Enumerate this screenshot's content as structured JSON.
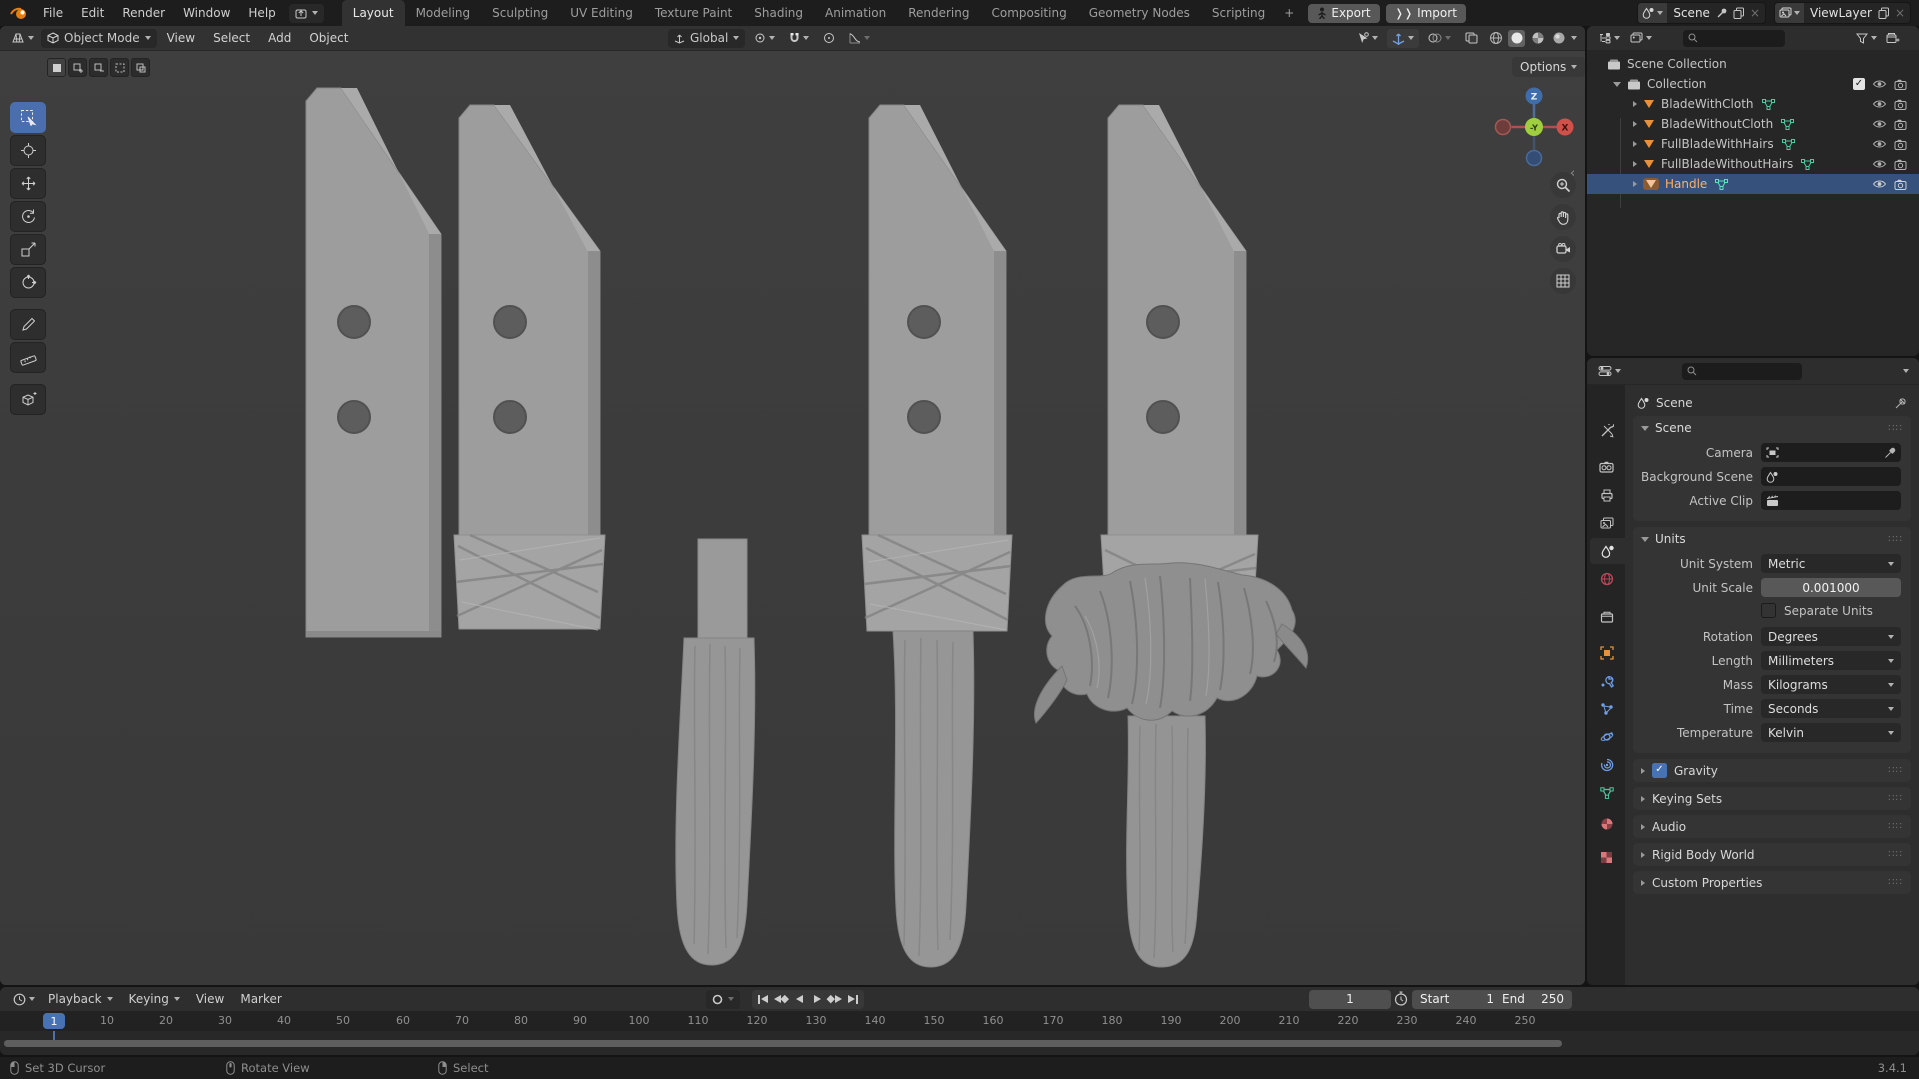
{
  "topbar": {
    "menus": [
      "File",
      "Edit",
      "Render",
      "Window",
      "Help"
    ],
    "workspaces": [
      "Layout",
      "Modeling",
      "Sculpting",
      "UV Editing",
      "Texture Paint",
      "Shading",
      "Animation",
      "Rendering",
      "Compositing",
      "Geometry Nodes",
      "Scripting"
    ],
    "active_workspace": "Layout",
    "add_tab": "+",
    "export_button": "Export",
    "import_button": "Import",
    "scene_name": "Scene",
    "view_layer_name": "ViewLayer"
  },
  "viewport": {
    "mode": "Object Mode",
    "menus": [
      "View",
      "Select",
      "Add",
      "Object"
    ],
    "orientation": "Global",
    "options_label": "Options",
    "gizmo": {
      "z": "Z",
      "x": "X",
      "y": "-Y"
    }
  },
  "outliner": {
    "rows": [
      {
        "label": "Scene Collection"
      },
      {
        "label": "Collection"
      },
      {
        "label": "BladeWithCloth"
      },
      {
        "label": "BladeWithoutCloth"
      },
      {
        "label": "FullBladeWithHairs"
      },
      {
        "label": "FullBladeWithoutHairs"
      },
      {
        "label": "Handle"
      }
    ]
  },
  "properties": {
    "breadcrumb": "Scene",
    "scene_panel": {
      "title": "Scene",
      "camera_label": "Camera",
      "background_label": "Background Scene",
      "clip_label": "Active Clip"
    },
    "units_panel": {
      "title": "Units",
      "system_label": "Unit System",
      "system_value": "Metric",
      "scale_label": "Unit Scale",
      "scale_value": "0.001000",
      "separate_label": "Separate Units",
      "rows": [
        {
          "label": "Rotation",
          "value": "Degrees"
        },
        {
          "label": "Length",
          "value": "Millimeters"
        },
        {
          "label": "Mass",
          "value": "Kilograms"
        },
        {
          "label": "Time",
          "value": "Seconds"
        },
        {
          "label": "Temperature",
          "value": "Kelvin"
        }
      ]
    },
    "collapsed_panels": [
      {
        "label": "Gravity",
        "checked": true
      },
      {
        "label": "Keying Sets"
      },
      {
        "label": "Audio"
      },
      {
        "label": "Rigid Body World"
      },
      {
        "label": "Custom Properties"
      }
    ]
  },
  "timeline": {
    "menus": [
      "Playback",
      "Keying",
      "View",
      "Marker"
    ],
    "current_frame": "1",
    "start_label": "Start",
    "start_value": "1",
    "end_label": "End",
    "end_value": "250",
    "ruler": [
      "10",
      "20",
      "30",
      "40",
      "50",
      "60",
      "70",
      "80",
      "90",
      "100",
      "110",
      "120",
      "130",
      "140",
      "150",
      "160",
      "170",
      "180",
      "190",
      "200",
      "210",
      "220",
      "230",
      "240",
      "250"
    ]
  },
  "statusbar": {
    "items": [
      {
        "label": "Set 3D Cursor"
      },
      {
        "label": "Rotate View"
      },
      {
        "label": "Select"
      }
    ],
    "version": "3.4.1"
  },
  "colors": {
    "accent": "#4772b4",
    "active_object_text": "#ffb060",
    "axis_x": "#d0504a",
    "axis_y": "#9fce3e",
    "axis_z": "#3e6daa"
  }
}
